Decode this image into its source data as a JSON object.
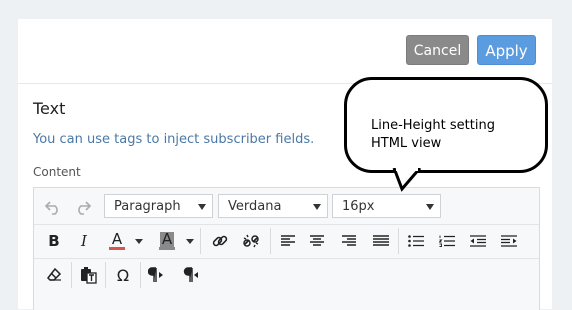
{
  "header": {
    "cancel_label": "Cancel",
    "apply_label": "Apply"
  },
  "section": {
    "title": "Text",
    "helper_text": "You can use tags to inject subscriber fields.",
    "content_label": "Content"
  },
  "editor": {
    "block_format": "Paragraph",
    "font_family": "Verdana",
    "font_size": "16px",
    "buttons": {
      "bold": "B",
      "italic": "I",
      "text_color": "A",
      "background_color": "A",
      "special_char": "Ω"
    },
    "colors": {
      "text_color_bar": "#d9534f",
      "bg_color_bar": "#8a8a8a"
    }
  },
  "annotation": {
    "line1": "Line-Height setting",
    "line2": "HTML view"
  },
  "icons": [
    "undo-icon",
    "redo-icon",
    "link-icon",
    "unlink-icon",
    "align-left-icon",
    "align-center-icon",
    "align-right-icon",
    "justify-icon",
    "bullet-list-icon",
    "numbered-list-icon",
    "outdent-icon",
    "indent-icon",
    "clear-format-icon",
    "paste-text-icon",
    "ltr-icon",
    "rtl-icon"
  ]
}
